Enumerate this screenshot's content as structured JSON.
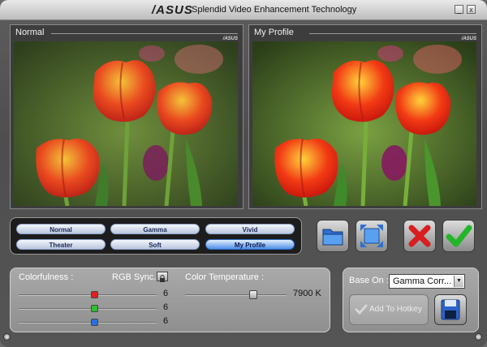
{
  "window": {
    "brand": "/ASUS",
    "title": "Splendid Video Enhancement Technology",
    "minimize_label": "_",
    "close_label": "x"
  },
  "preview": {
    "left_label": "Normal",
    "right_label": "My Profile",
    "watermark": "/ASUS"
  },
  "modes": [
    {
      "label": "Normal",
      "active": false
    },
    {
      "label": "Gamma",
      "active": false
    },
    {
      "label": "Vivid",
      "active": false
    },
    {
      "label": "Theater",
      "active": false
    },
    {
      "label": "Soft",
      "active": false
    },
    {
      "label": "My Profile",
      "active": true
    }
  ],
  "controls": {
    "colorfulness_label": "Colorfulness :",
    "rgb_sync_label": "RGB Sync.",
    "color_temperature_label": "Color Temperature :",
    "red_value": "6",
    "green_value": "6",
    "blue_value": "6",
    "temperature_value": "7900 K"
  },
  "settings": {
    "base_on_label": "Base On :",
    "base_on_value": "Gamma Corr...",
    "add_hotkey_label": "Add To Hotkey"
  },
  "colors": {
    "red": "#e02020",
    "green": "#2fbf2f",
    "blue": "#2a6fe0",
    "active_mode": "#4f8fe6"
  }
}
